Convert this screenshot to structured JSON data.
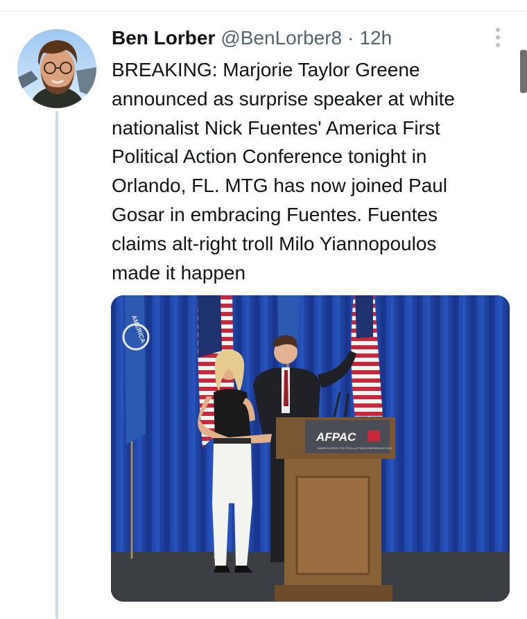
{
  "tweet": {
    "author": {
      "display_name": "Ben Lorber",
      "handle": "@BenLorber8",
      "separator": "·",
      "timestamp": "12h"
    },
    "text": "BREAKING: Marjorie Taylor Greene\nannounced as surprise speaker at white\nnationalist Nick Fuentes' America First\nPolitical Action Conference tonight in\nOrlando, FL. MTG has now joined Paul\nGosar in embracing Fuentes. Fuentes\nclaims alt-right troll Milo Yiannopoulos\nmade it happen",
    "media": {
      "podium_logo": "AFPAC",
      "podium_subtitle": "AMERICA FIRST POLITICAL ACTION CONFERENCE 2022",
      "flag_text": "AMERICA"
    }
  },
  "icons": {
    "more": "more-horizontal-icon"
  },
  "colors": {
    "text_primary": "#0f1419",
    "text_secondary": "#536471",
    "divider": "#e6ecf0",
    "thread_line": "#cfd9de",
    "curtain": "#1e3f9e"
  }
}
